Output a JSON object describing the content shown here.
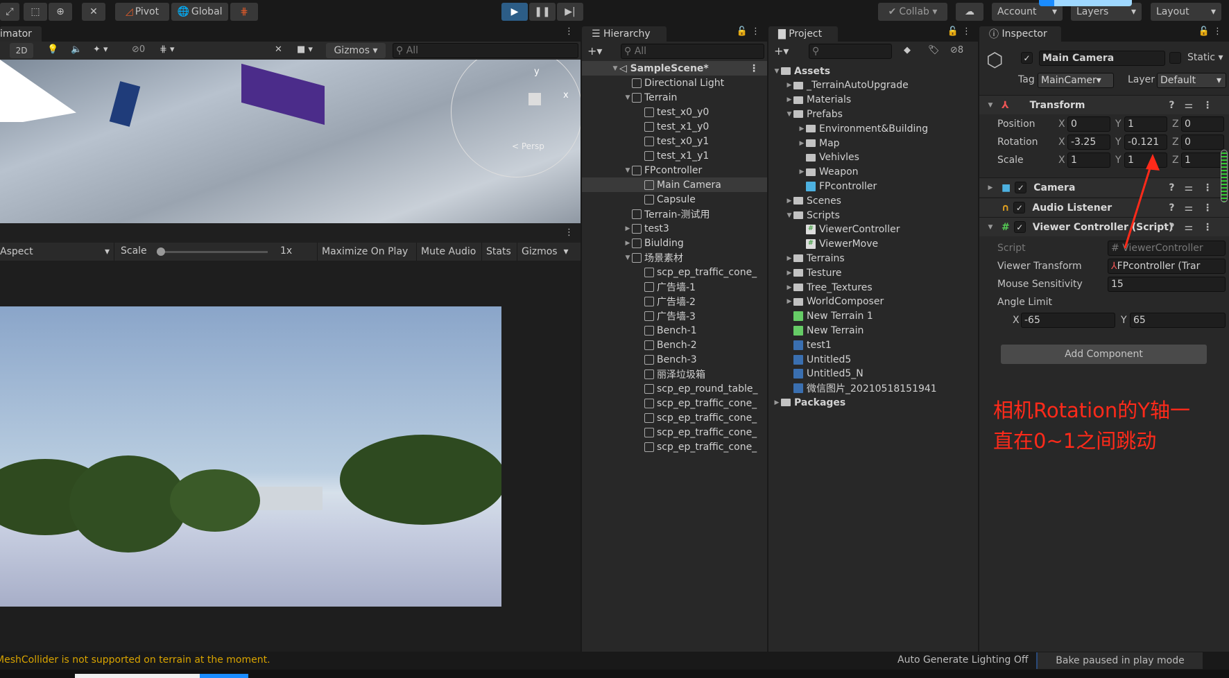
{
  "toolbar": {
    "pivot": "Pivot",
    "global": "Global",
    "collab": "Collab",
    "account": "Account",
    "layers": "Layers",
    "layout": "Layout",
    "accent": "#2c5d87"
  },
  "scene": {
    "tab": "imator",
    "mode2d": "2D",
    "hidden_count": "0",
    "gizmos": "Gizmos",
    "search_placeholder": "All",
    "persp": "< Persp",
    "axis_x": "x",
    "axis_y": "y"
  },
  "game": {
    "aspect": "Aspect",
    "scale_label": "Scale",
    "scale_value": "1x",
    "scale_fraction": 0,
    "maximize": "Maximize On Play",
    "mute": "Mute Audio",
    "stats": "Stats",
    "gizmos": "Gizmos"
  },
  "hierarchy": {
    "title": "Hierarchy",
    "search_placeholder": "All",
    "scene": "SampleScene*",
    "items": [
      {
        "label": "Directional Light",
        "level": 1,
        "expand": ""
      },
      {
        "label": "Terrain",
        "level": 1,
        "expand": "open"
      },
      {
        "label": "test_x0_y0",
        "level": 2,
        "expand": ""
      },
      {
        "label": "test_x1_y0",
        "level": 2,
        "expand": ""
      },
      {
        "label": "test_x0_y1",
        "level": 2,
        "expand": ""
      },
      {
        "label": "test_x1_y1",
        "level": 2,
        "expand": ""
      },
      {
        "label": "FPcontroller",
        "level": 1,
        "expand": "open"
      },
      {
        "label": "Main Camera",
        "level": 2,
        "expand": "",
        "selected": true
      },
      {
        "label": "Capsule",
        "level": 2,
        "expand": ""
      },
      {
        "label": "Terrain-测试用",
        "level": 1,
        "expand": ""
      },
      {
        "label": "test3",
        "level": 1,
        "expand": "closed"
      },
      {
        "label": "Biulding",
        "level": 1,
        "expand": "closed"
      },
      {
        "label": "场景素材",
        "level": 1,
        "expand": "open"
      },
      {
        "label": "scp_ep_traffic_cone_",
        "level": 2,
        "expand": ""
      },
      {
        "label": "广告墙-1",
        "level": 2,
        "expand": ""
      },
      {
        "label": "广告墙-2",
        "level": 2,
        "expand": ""
      },
      {
        "label": "广告墙-3",
        "level": 2,
        "expand": ""
      },
      {
        "label": "Bench-1",
        "level": 2,
        "expand": ""
      },
      {
        "label": "Bench-2",
        "level": 2,
        "expand": ""
      },
      {
        "label": "Bench-3",
        "level": 2,
        "expand": ""
      },
      {
        "label": "丽泽垃圾箱",
        "level": 2,
        "expand": ""
      },
      {
        "label": "scp_ep_round_table_",
        "level": 2,
        "expand": ""
      },
      {
        "label": "scp_ep_traffic_cone_",
        "level": 2,
        "expand": ""
      },
      {
        "label": "scp_ep_traffic_cone_",
        "level": 2,
        "expand": ""
      },
      {
        "label": "scp_ep_traffic_cone_",
        "level": 2,
        "expand": ""
      },
      {
        "label": "scp_ep_traffic_cone_",
        "level": 2,
        "expand": ""
      }
    ]
  },
  "project": {
    "title": "Project",
    "hidden_count": "8",
    "items": [
      {
        "label": "Assets",
        "level": 0,
        "expand": "open",
        "type": "folder-open",
        "bold": true
      },
      {
        "label": "_TerrainAutoUpgrade",
        "level": 1,
        "expand": "closed",
        "type": "folder"
      },
      {
        "label": "Materials",
        "level": 1,
        "expand": "closed",
        "type": "folder"
      },
      {
        "label": "Prefabs",
        "level": 1,
        "expand": "open",
        "type": "folder-open"
      },
      {
        "label": "Environment&Building",
        "level": 2,
        "expand": "closed",
        "type": "folder"
      },
      {
        "label": "Map",
        "level": 2,
        "expand": "closed",
        "type": "folder"
      },
      {
        "label": "Vehivles",
        "level": 2,
        "expand": "",
        "type": "folder"
      },
      {
        "label": "Weapon",
        "level": 2,
        "expand": "closed",
        "type": "folder"
      },
      {
        "label": "FPcontroller",
        "level": 2,
        "expand": "",
        "type": "prefab"
      },
      {
        "label": "Scenes",
        "level": 1,
        "expand": "closed",
        "type": "folder"
      },
      {
        "label": "Scripts",
        "level": 1,
        "expand": "open",
        "type": "folder-open"
      },
      {
        "label": "ViewerController",
        "level": 2,
        "expand": "",
        "type": "script"
      },
      {
        "label": "ViewerMove",
        "level": 2,
        "expand": "",
        "type": "script"
      },
      {
        "label": "Terrains",
        "level": 1,
        "expand": "closed",
        "type": "folder"
      },
      {
        "label": "Testure",
        "level": 1,
        "expand": "closed",
        "type": "folder"
      },
      {
        "label": "Tree_Textures",
        "level": 1,
        "expand": "closed",
        "type": "folder"
      },
      {
        "label": "WorldComposer",
        "level": 1,
        "expand": "closed",
        "type": "folder"
      },
      {
        "label": "New Terrain 1",
        "level": 1,
        "expand": "",
        "type": "terrain"
      },
      {
        "label": "New Terrain",
        "level": 1,
        "expand": "",
        "type": "terrain"
      },
      {
        "label": "test1",
        "level": 1,
        "expand": "",
        "type": "image"
      },
      {
        "label": "Untitled5",
        "level": 1,
        "expand": "",
        "type": "image"
      },
      {
        "label": "Untitled5_N",
        "level": 1,
        "expand": "",
        "type": "image"
      },
      {
        "label": "微信图片_20210518151941",
        "level": 1,
        "expand": "",
        "type": "image"
      },
      {
        "label": "Packages",
        "level": 0,
        "expand": "closed",
        "type": "folder",
        "bold": true
      }
    ]
  },
  "inspector": {
    "title": "Inspector",
    "name": "Main Camera",
    "static": "Static",
    "tag_label": "Tag",
    "tag": "MainCamer",
    "layer_label": "Layer",
    "layer": "Default",
    "transform": {
      "title": "Transform",
      "position_label": "Position",
      "rotation_label": "Rotation",
      "scale_label": "Scale",
      "position": [
        "0",
        "1",
        "0"
      ],
      "rotation": [
        "-3.25",
        "-0.121",
        "0"
      ],
      "scale": [
        "1",
        "1",
        "1"
      ]
    },
    "camera": "Camera",
    "audio": "Audio Listener",
    "script": {
      "title": "Viewer Controller (Script)",
      "script_label": "Script",
      "script_value": "ViewerController",
      "viewer_label": "Viewer Transform",
      "viewer_value": "FPcontroller (Trar",
      "mouse_label": "Mouse Sensitivity",
      "mouse_value": "15",
      "angle_label": "Angle Limit",
      "angle_x": "-65",
      "angle_y": "65"
    },
    "add_component": "Add Component"
  },
  "annotation": {
    "line1": "相机Rotation的Y轴一",
    "line2": "直在0~1之间跳动",
    "color": "#ff2a1a"
  },
  "status": {
    "warning": "MeshCollider is not supported on terrain at the moment.",
    "lighting": "Auto Generate Lighting Off",
    "bake": "Bake paused in play mode",
    "warning_color": "#d9a400"
  }
}
